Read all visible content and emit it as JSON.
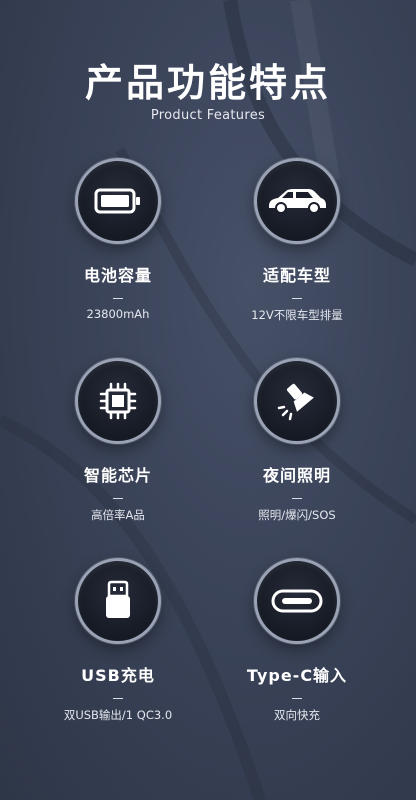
{
  "header": {
    "title": "产品功能特点",
    "subtitle": "Product Features"
  },
  "features": [
    {
      "name": "电池容量",
      "desc": "23800mAh",
      "icon": "battery-icon"
    },
    {
      "name": "适配车型",
      "desc": "12V不限车型排量",
      "icon": "car-icon"
    },
    {
      "name": "智能芯片",
      "desc": "高倍率A品",
      "icon": "chip-icon"
    },
    {
      "name": "夜间照明",
      "desc": "照明/爆闪/SOS",
      "icon": "flashlight-icon"
    },
    {
      "name": "USB充电",
      "desc": "双USB输出/1 QC3.0",
      "icon": "usb-icon"
    },
    {
      "name": "Type-C输入",
      "desc": "双向快充",
      "icon": "type-c-icon"
    }
  ],
  "colors": {
    "background": "#3a4358",
    "circle_fill": "#161a24",
    "circle_ring": "#9aa3b6",
    "text": "#ffffff"
  }
}
